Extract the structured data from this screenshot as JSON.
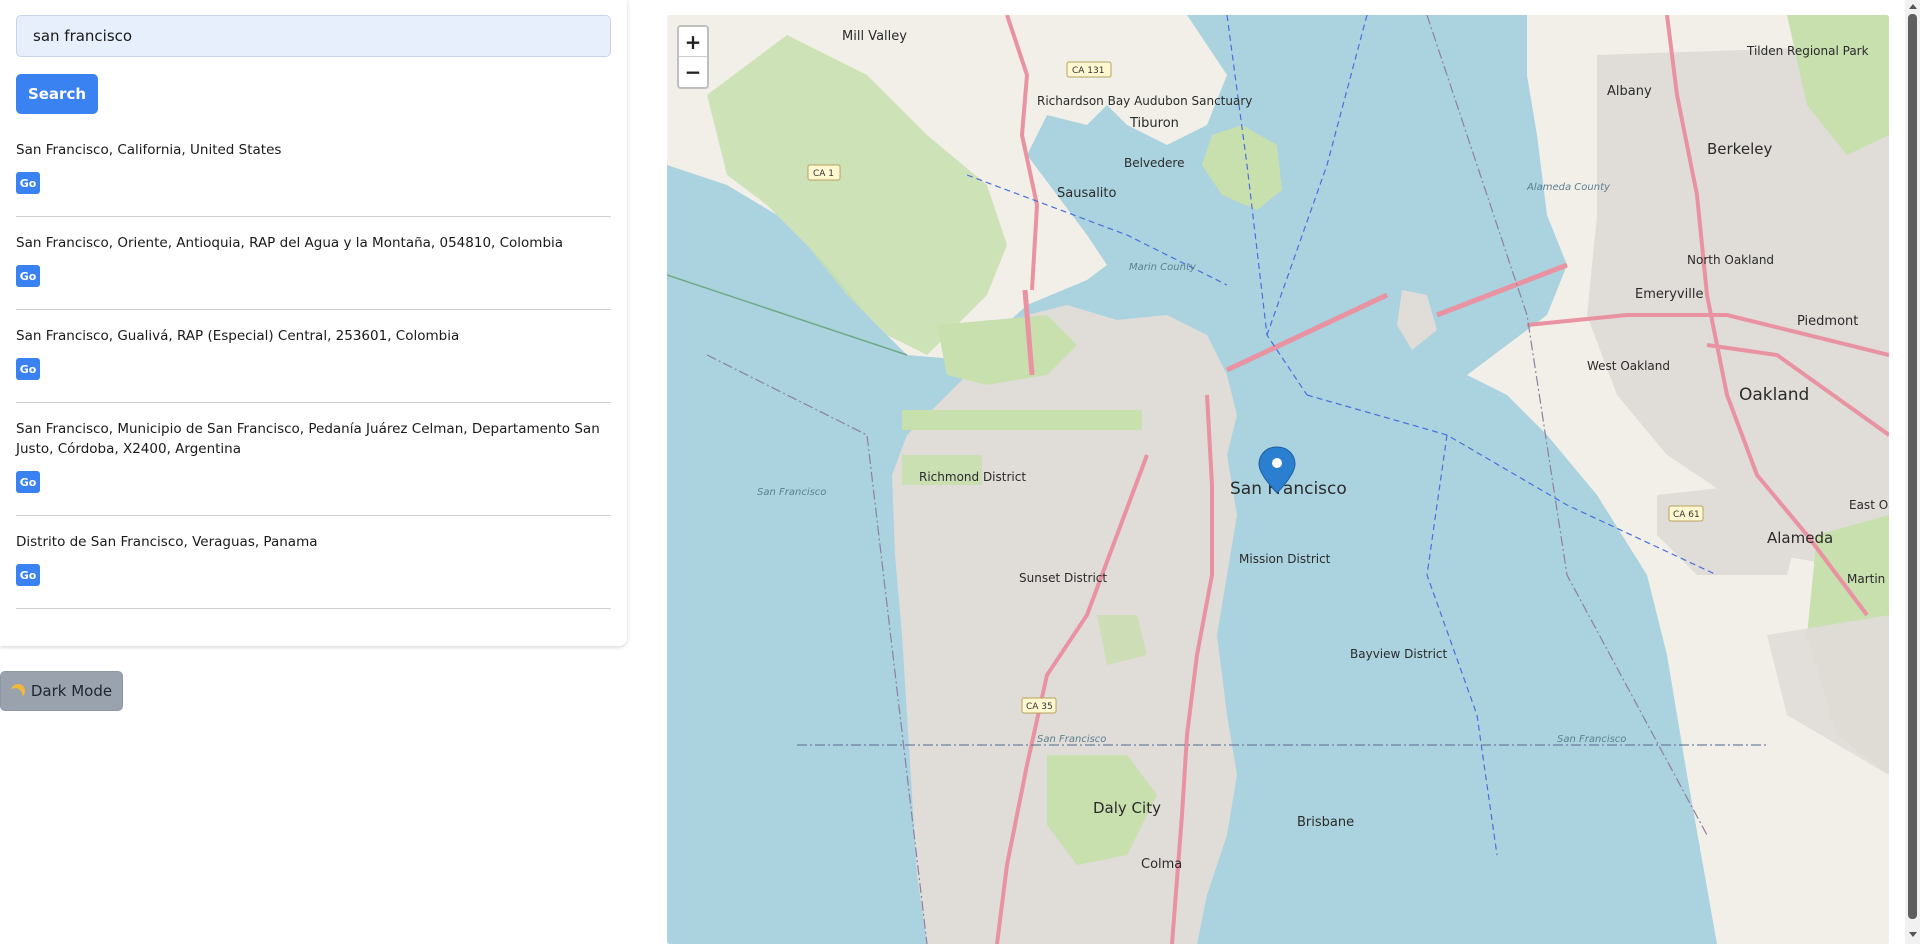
{
  "search": {
    "value": "san francisco",
    "button_label": "Search"
  },
  "results": [
    {
      "label": "San Francisco, California, United States",
      "go_label": "Go"
    },
    {
      "label": "San Francisco, Oriente, Antioquia, RAP del Agua y la Montaña, 054810, Colombia",
      "go_label": "Go"
    },
    {
      "label": "San Francisco, Gualivá, RAP (Especial) Central, 253601, Colombia",
      "go_label": "Go"
    },
    {
      "label": "San Francisco, Municipio de San Francisco, Pedanía Juárez Celman, Departamento San Justo, Córdoba, X2400, Argentina",
      "go_label": "Go"
    },
    {
      "label": "Distrito de San Francisco, Veraguas, Panama",
      "go_label": "Go"
    }
  ],
  "dark_mode": {
    "label": "Dark Mode",
    "icon": "moon-icon"
  },
  "map": {
    "zoom_in": "+",
    "zoom_out": "−",
    "marker_icon": "map-pin-icon",
    "places": {
      "mill_valley": "Mill Valley",
      "tiburon": "Tiburon",
      "belvedere": "Belvedere",
      "sausalito": "Sausalito",
      "richardson_bay": "Richardson Bay Audubon Sanctuary",
      "albany": "Albany",
      "berkeley": "Berkeley",
      "tilden": "Tilden Regional Park",
      "north_oakland": "North Oakland",
      "emeryville": "Emeryville",
      "piedmont": "Piedmont",
      "west_oakland": "West Oakland",
      "oakland": "Oakland",
      "alameda": "Alameda",
      "east_oakland": "East Oakl",
      "san_francisco": "San Francisco",
      "richmond_district": "Richmond District",
      "sunset_district": "Sunset District",
      "mission_district": "Mission District",
      "bayview_district": "Bayview District",
      "daly_city": "Daly City",
      "brisbane": "Brisbane",
      "colma": "Colma",
      "martin_luther_king": "Martin Luther King Jr. Regional Shoreline",
      "marin_county": "Marin County",
      "alameda_county": "Alameda County",
      "sf_water_1": "San Francisco",
      "sf_water_2": "San Francisco",
      "sf_bay_label": "San Francisco"
    },
    "shields": {
      "ca131": "CA 131",
      "ca1": "CA 1",
      "ca35": "CA 35",
      "ca61": "CA 61"
    },
    "colors": {
      "water": "#aad3df",
      "land": "#f2efe9",
      "park": "#c8dfae",
      "urban": "#e0dcd8",
      "highway": "#e892a2",
      "boundary": "#4a6fdc",
      "marker": "#2a7fd0"
    }
  }
}
